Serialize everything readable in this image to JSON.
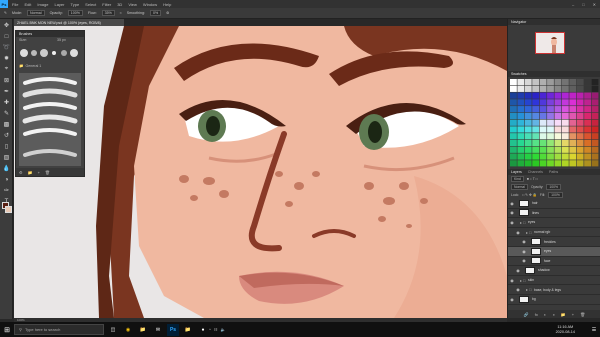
{
  "app": {
    "menu": [
      "File",
      "Edit",
      "Image",
      "Layer",
      "Type",
      "Select",
      "Filter",
      "3D",
      "View",
      "Window",
      "Help"
    ],
    "logo": "Ps"
  },
  "options": {
    "mode_label": "Mode:",
    "mode_value": "Normal",
    "opacity_label": "Opacity:",
    "opacity_value": "100%",
    "flow_label": "Flow:",
    "flow_value": "35%",
    "smoothing_label": "Smoothing:",
    "smoothing_value": "0%"
  },
  "document": {
    "tab_title": "ZHAEL BNK MON NEW.psd @ 100% (eyes, RGB/8)"
  },
  "brushes_panel": {
    "title": "Brushes",
    "size_label": "Size:",
    "size_value": "35 px",
    "group_label": "General 1"
  },
  "right_panels": {
    "navigator_tab": "Navigator",
    "swatches_tab": "Swatches",
    "layers_tab": "Layers",
    "channels_tab": "Channels",
    "paths_tab": "Paths",
    "kind_label": "Kind",
    "blend_value": "Normal",
    "opacity_label": "Opacity:",
    "opacity_value": "100%",
    "lock_label": "Lock:",
    "fill_label": "Fill:",
    "fill_value": "100%"
  },
  "layers": [
    {
      "name": "hair",
      "type": "layer",
      "indent": 0,
      "selected": false
    },
    {
      "name": "lines",
      "type": "layer",
      "indent": 0,
      "selected": false
    },
    {
      "name": "eyes",
      "type": "folder",
      "indent": 0,
      "selected": false
    },
    {
      "name": "normal rgb",
      "type": "folder",
      "indent": 1,
      "selected": false
    },
    {
      "name": "freckles",
      "type": "layer",
      "indent": 2,
      "selected": false
    },
    {
      "name": "eyes",
      "type": "layer",
      "indent": 2,
      "selected": true
    },
    {
      "name": "face",
      "type": "layer",
      "indent": 2,
      "selected": false
    },
    {
      "name": "shadow",
      "type": "layer",
      "indent": 1,
      "selected": false
    },
    {
      "name": "skin",
      "type": "folder",
      "indent": 0,
      "selected": false
    },
    {
      "name": "base, body & legs",
      "type": "folder",
      "indent": 1,
      "selected": false
    },
    {
      "name": "bg",
      "type": "layer",
      "indent": 0,
      "selected": false
    }
  ],
  "status": {
    "zoom": "100%"
  },
  "taskbar": {
    "search_placeholder": "Type here to search",
    "time": "11:16 AM",
    "date": "2020-08-14"
  },
  "colors": {
    "accent": "#31a8ff",
    "canvas_bg": "#e9e6e6",
    "skin": "#f0b8a0",
    "hair": "#7a3520",
    "iris": "#5e7a52"
  }
}
